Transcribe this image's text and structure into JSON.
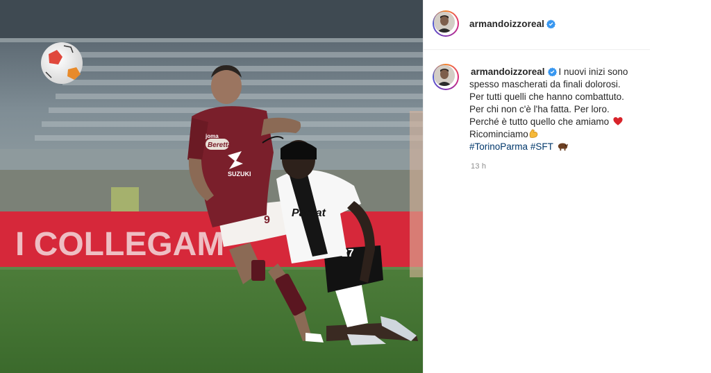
{
  "post": {
    "username": "armandoizzoreal",
    "verified": true,
    "caption_lines": [
      "I nuovi inizi sono",
      "spesso mascherati da finali dolorosi.",
      "Per tutti quelli che hanno combattuto.",
      "Per chi non c'è l'ha fatta. Per loro.",
      "Perché è tutto quello che amiamo",
      "Ricominciamo"
    ],
    "hashtags": [
      "#TorinoParma",
      "#SFT"
    ],
    "time": "13 h"
  },
  "photo": {
    "board_text": "I COLLEGAM",
    "player_left": {
      "sponsor": "Beretta",
      "brand": "SUZUKI",
      "kit": "joma",
      "number": "9"
    },
    "player_right": {
      "sponsor": "Parilat",
      "number": "27"
    }
  },
  "colors": {
    "verified": "#3897f0",
    "hashtag": "#00376b",
    "text": "#262626",
    "meta": "#8e8e8e",
    "heart": "#ed4956",
    "torino": "#7a1f2b",
    "board": "#d6283a"
  },
  "icons": [
    "verified-badge-icon",
    "heart-emoji-icon",
    "flexed-biceps-emoji-icon",
    "bull-emoji-icon"
  ]
}
